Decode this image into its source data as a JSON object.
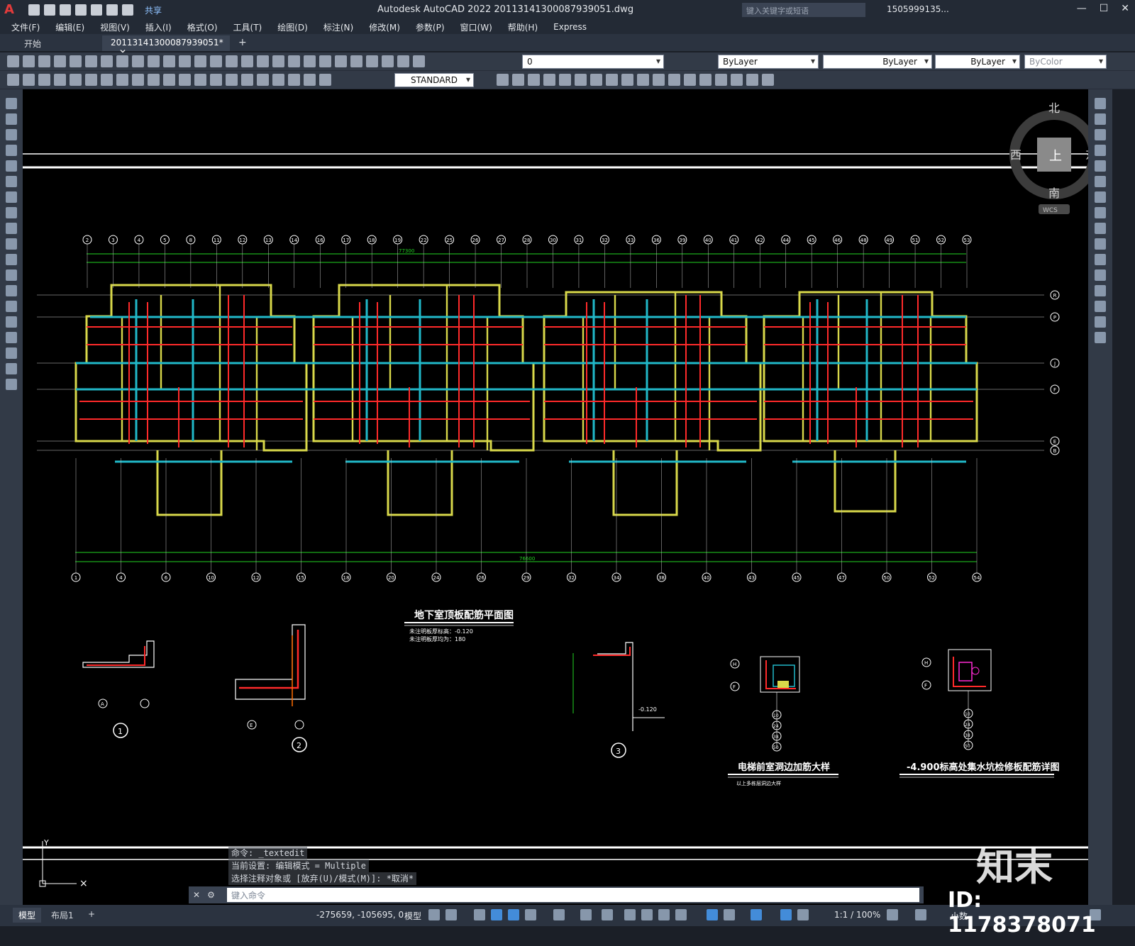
{
  "titlebar": {
    "app_letter": "A",
    "share_label": "共享",
    "title": "Autodesk AutoCAD 2022    20113141300087939051.dwg",
    "search_placeholder": "键入关键字或短语",
    "user": "1505999135...",
    "window_controls": [
      "—",
      "☐",
      "✕"
    ]
  },
  "menu": {
    "items": [
      "文件(F)",
      "编辑(E)",
      "视图(V)",
      "插入(I)",
      "格式(O)",
      "工具(T)",
      "绘图(D)",
      "标注(N)",
      "修改(M)",
      "参数(P)",
      "窗口(W)",
      "帮助(H)",
      "Express"
    ]
  },
  "tabs": {
    "start": "开始",
    "document": "20113141300087939051*",
    "close": "✕",
    "new": "+"
  },
  "toolbar": {
    "layer_value": "0",
    "color": "ByLayer",
    "linetype": "ByLayer",
    "lineweight": "ByLayer",
    "plotstyle": "ByColor",
    "text_style": "STANDARD"
  },
  "viewcube": {
    "north": "北",
    "south": "南",
    "east": "东",
    "west": "西",
    "top": "上",
    "wcs": "WCS"
  },
  "drawing": {
    "main_title": "地下室顶板配筋平面图",
    "note1": "未注明板厚标高：-0.120",
    "note2": "未注明板厚均为：180",
    "detail_title_1": "电梯前室洞边加筋大样",
    "detail_sub_1": "以上多栋层洞边大样",
    "detail_title_2": "-4.900标高处集水坑检修板配筋详图",
    "level_label": "-0.120",
    "top_dim": "77300",
    "bottom_dim": "76600",
    "top_axes": [
      "2",
      "3",
      "4",
      "5",
      "8",
      "11",
      "12",
      "13",
      "14",
      "16",
      "17",
      "18",
      "19",
      "22",
      "25",
      "26",
      "27",
      "28",
      "30",
      "31",
      "32",
      "33",
      "36",
      "39",
      "40",
      "41",
      "42",
      "44",
      "45",
      "46",
      "48",
      "49",
      "51",
      "52",
      "53"
    ],
    "bottom_axes": [
      "1",
      "4",
      "6",
      "10",
      "12",
      "15",
      "18",
      "20",
      "24",
      "26",
      "29",
      "32",
      "34",
      "38",
      "40",
      "43",
      "45",
      "47",
      "50",
      "52",
      "54"
    ],
    "right_axes": [
      "R",
      "P",
      "J",
      "F",
      "E",
      "B"
    ],
    "detail_markers": [
      "1",
      "2",
      "3"
    ],
    "detail_axes_a": [
      "A"
    ],
    "detail_axes_e": [
      "E"
    ],
    "detail_axes_hf": [
      "H",
      "F"
    ],
    "detail_axes_stack": [
      "10",
      "24",
      "38",
      "50"
    ]
  },
  "command": {
    "history": [
      "命令: _textedit",
      "当前设置: 编辑模式 = Multiple",
      "选择注释对象或 [放弃(U)/模式(M)]: *取消*"
    ],
    "placeholder": "键入命令"
  },
  "status": {
    "model_tab": "模型",
    "layout_tab": "布局1",
    "add": "+",
    "coordinates": "-275659, -105695, 0",
    "space": "模型",
    "scale": "1:1 / 100%",
    "units": "小数"
  },
  "watermark": {
    "logo": "知末",
    "id": "ID: 1178378071"
  },
  "colors": {
    "background": "#000000",
    "wall": "#d8d84a",
    "rebar": "#ff2a2a",
    "beam": "#21b8c8",
    "dimension": "#22d322",
    "axis": "#ffffff"
  }
}
